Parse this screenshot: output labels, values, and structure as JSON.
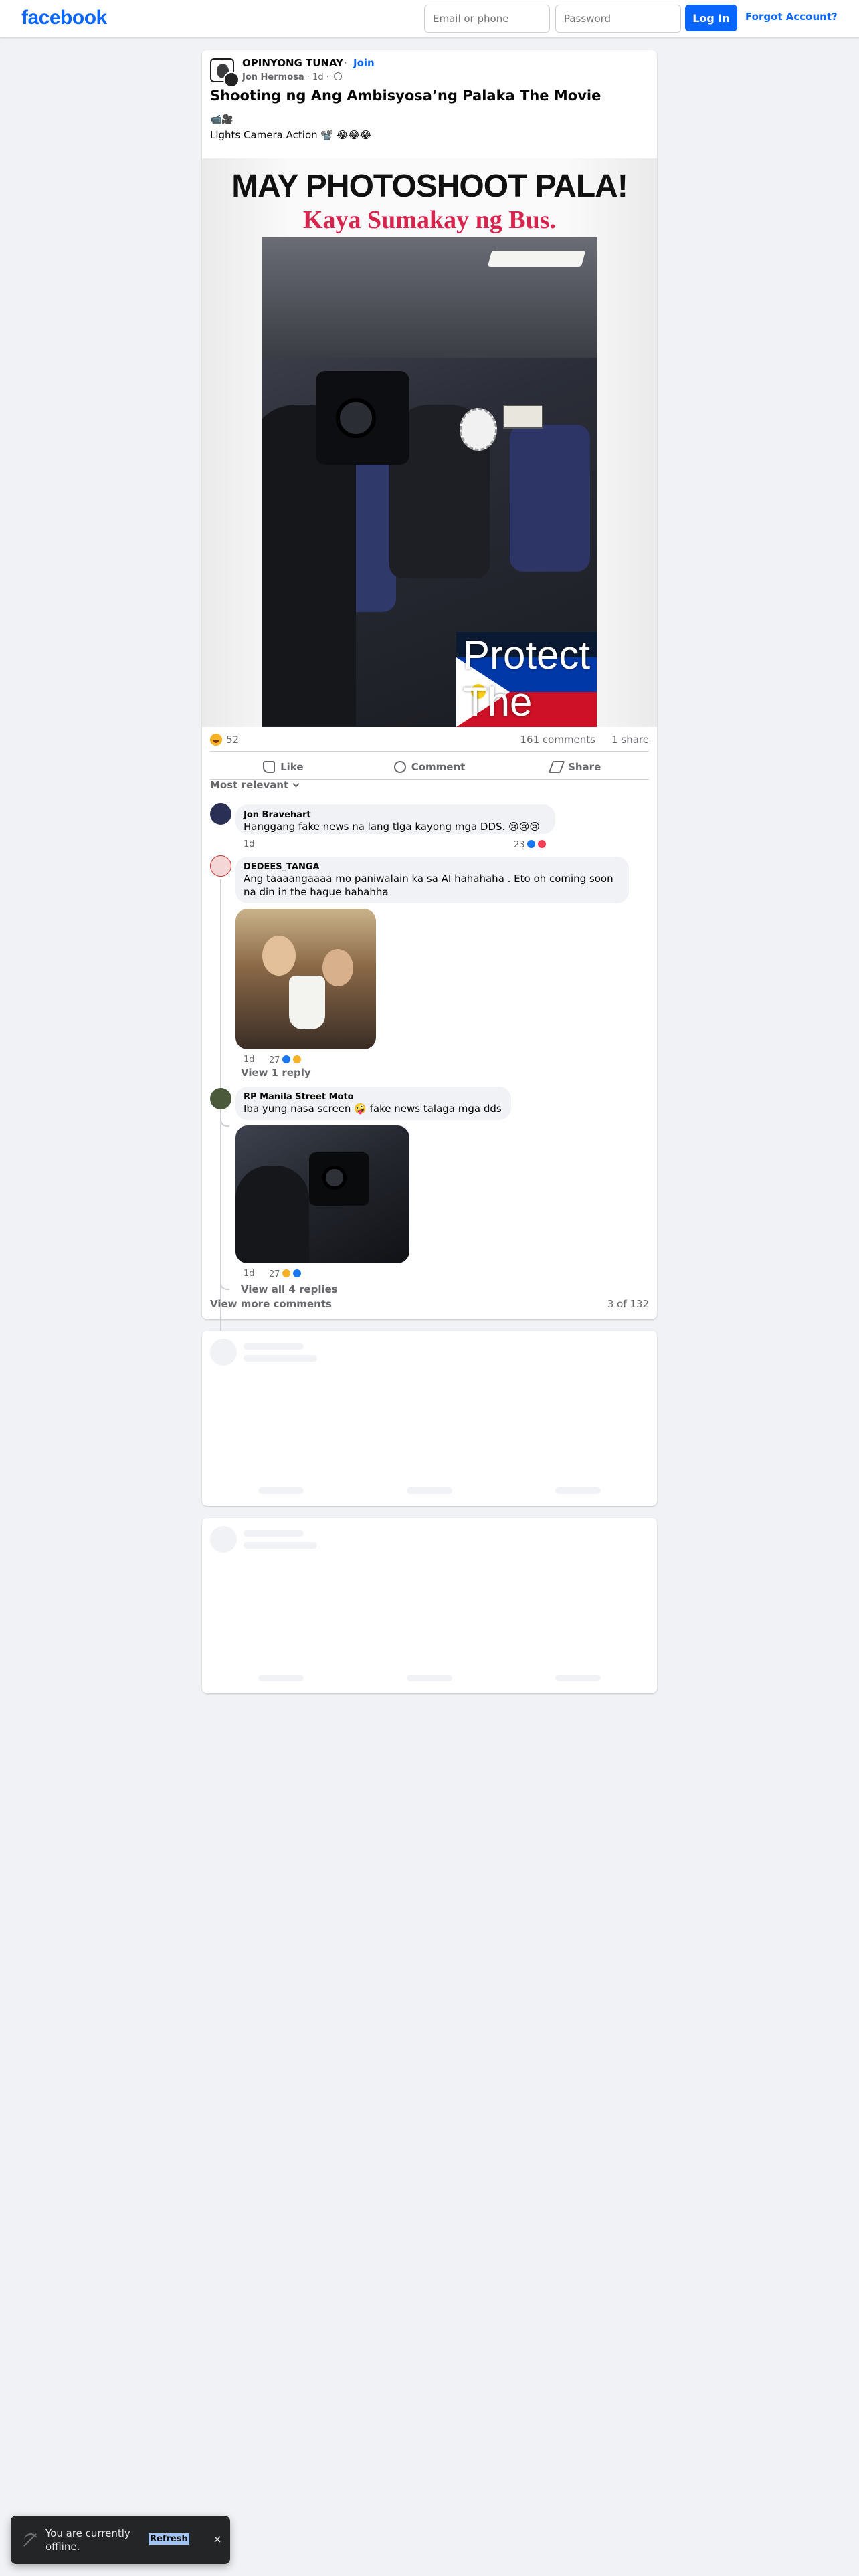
{
  "header": {
    "logo": "facebook",
    "email_placeholder": "Email or phone",
    "password_placeholder": "Password",
    "login_label": "Log In",
    "forgot_label": "Forgot Account?"
  },
  "post": {
    "group_name": "OPINYONG TUNAY",
    "separator": "·",
    "join_label": "Join",
    "author": "Jon Hermosa",
    "time": " · 1d · ",
    "title": "Shooting ng Ang Ambisyosa’ng Palaka The Movie",
    "emoji_line": "📹🎥",
    "text": "Lights Camera Action 📽️ 😂😂😂",
    "image": {
      "headline": "MAY PHOTOSHOOT PALA!",
      "subheadline": "Kaya Sumakay ng Bus.",
      "overlay_text": "Protect The VP"
    },
    "reaction_count": "52",
    "comments_count": "161 comments",
    "shares_count": "1 share",
    "actions": {
      "like": "Like",
      "comment": "Comment",
      "share": "Share"
    },
    "sort_label": "Most relevant"
  },
  "comments": [
    {
      "name": "Jon Bravehart",
      "text": "Hanggang fake news na lang tlga kayong mga DDS. 😢😢😢",
      "time": "1d",
      "reactions": "23"
    },
    {
      "name": "DEDEES_TANGA",
      "text": "Ang taaaangaaaa mo paniwalain ka sa AI hahahaha . Eto oh coming soon na din in the hague hahahha",
      "time": "1d",
      "reactions": "27",
      "replies_label": "View 1 reply"
    },
    {
      "name": "RP Manila Street Moto",
      "text": "Iba yung nasa screen 🤪 fake news talaga mga dds",
      "time": "1d",
      "reactions": "27",
      "replies_label": "View all 4 replies"
    }
  ],
  "view_more_label": "View more comments",
  "pager": "3 of 132",
  "toast": {
    "message": "You are currently offline.",
    "action": "Refresh",
    "close": "×"
  },
  "colors": {
    "brand": "#0866ff",
    "background": "#f0f2f5",
    "headline_red": "#d6244c"
  }
}
